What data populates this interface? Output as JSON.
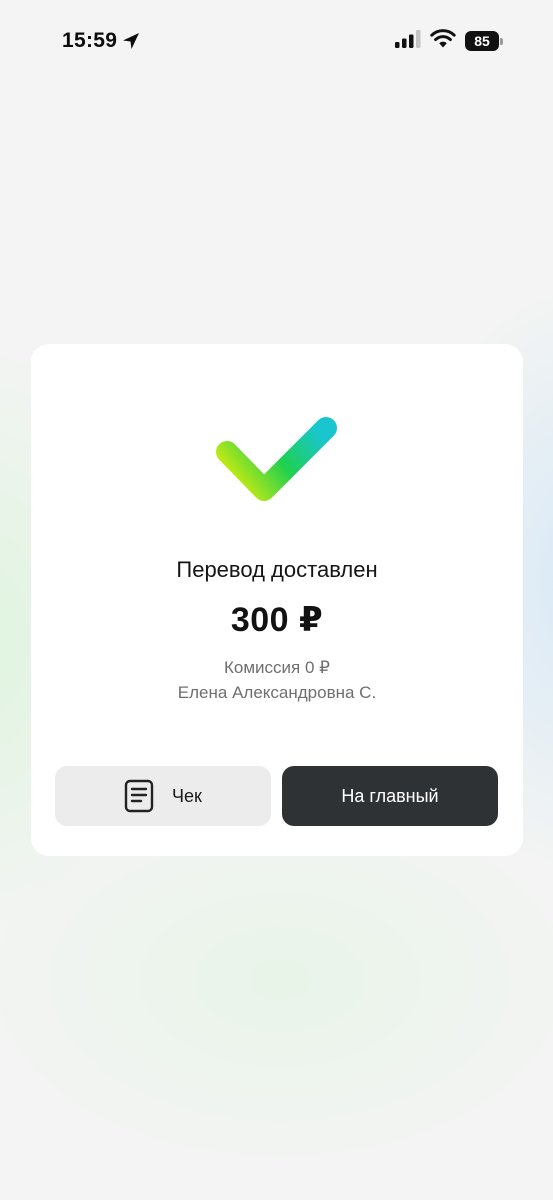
{
  "status_bar": {
    "time": "15:59",
    "battery": "85",
    "icons": [
      "location-arrow-icon",
      "cellular-signal-icon",
      "wifi-icon",
      "battery-icon"
    ]
  },
  "result": {
    "icon": "success-checkmark-icon",
    "title": "Перевод доставлен",
    "amount": "300 ₽",
    "fee": "Комиссия 0 ₽",
    "recipient": "Елена Александровна С."
  },
  "actions": {
    "receipt_label": "Чек",
    "receipt_icon": "receipt-icon",
    "home_label": "На главный"
  },
  "colors": {
    "check_gradient_start": "#c6ea12",
    "check_gradient_mid": "#1fd04f",
    "check_gradient_end": "#19c6cf",
    "primary_button": "#2f3235",
    "secondary_button": "#ececec"
  }
}
